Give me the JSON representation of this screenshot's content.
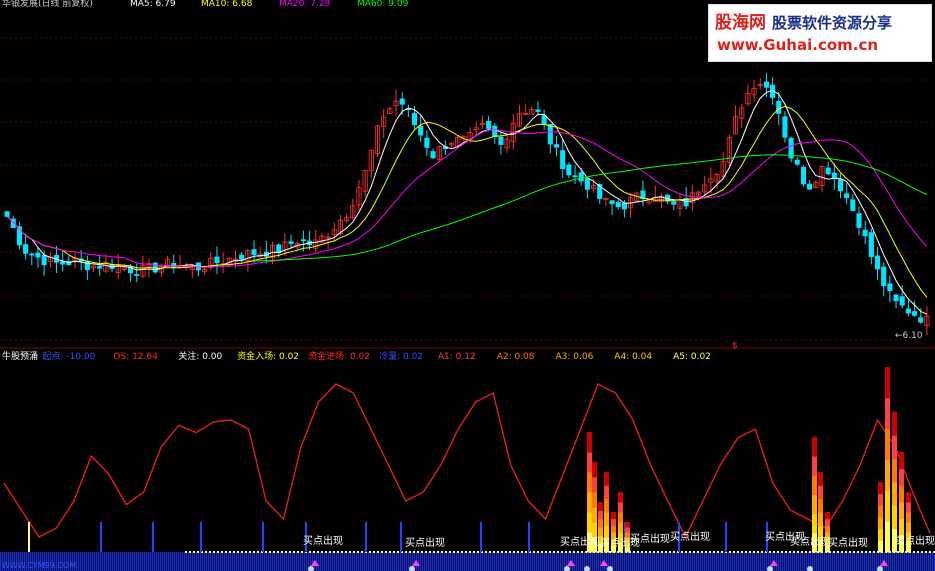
{
  "top_legend": [
    {
      "text": "华银发展(日线 前复权)",
      "color": "#c8c8c8"
    },
    {
      "text": "MA5: 6.79",
      "color": "#ffffff"
    },
    {
      "text": "MA10: 6.68",
      "color": "#ffff00"
    },
    {
      "text": "MA20: 7.29",
      "color": "#ff00ff"
    },
    {
      "text": "MA60: 9.09",
      "color": "#00ff00"
    }
  ],
  "low_label": "6.10",
  "watermark": {
    "line1": "股海网",
    "line2": "股票软件资源分享",
    "line3": "www.Guhai.com.cn"
  },
  "bottom_watermark": "WWW.CYM99.COM",
  "indicator_legend": [
    {
      "text": "牛股预涌",
      "color": "#ffffff"
    },
    {
      "text": "起点: -10.00",
      "color": "#3355ff"
    },
    {
      "text": "OS: 12.64",
      "color": "#ff2a2a"
    },
    {
      "text": "关注: 0.00",
      "color": "#ffffff"
    },
    {
      "text": "资金入场: 0.02",
      "color": "#ffff00"
    },
    {
      "text": "资金进场: 0.02",
      "color": "#ff2a2a"
    },
    {
      "text": "冷量: 0.02",
      "color": "#3355ff"
    },
    {
      "text": "A1: 0.12",
      "color": "#ff4040"
    },
    {
      "text": "A2: 0.08",
      "color": "#ff7a00"
    },
    {
      "text": "A3: 0.06",
      "color": "#ffaa00"
    },
    {
      "text": "A4: 0.04",
      "color": "#ffd200"
    },
    {
      "text": "A5: 0.02",
      "color": "#ffff60"
    }
  ],
  "signal_label": "买点出现",
  "chart_data": [
    {
      "type": "candlestick",
      "title": "华银发展(日线 前复权)",
      "series": [
        {
          "name": "MA5",
          "value": 6.79,
          "color": "#ffffff"
        },
        {
          "name": "MA10",
          "value": 6.68,
          "color": "#ffff00"
        },
        {
          "name": "MA20",
          "value": 7.29,
          "color": "#ff00ff"
        },
        {
          "name": "MA60",
          "value": 9.09,
          "color": "#00ff00"
        }
      ],
      "close_path": [
        8.3,
        7.6,
        7.4,
        7.3,
        7.35,
        7.25,
        7.3,
        7.2,
        7.15,
        7.25,
        7.3,
        7.2,
        7.3,
        7.4,
        7.5,
        7.55,
        7.6,
        7.8,
        7.7,
        8.0,
        8.4,
        9.2,
        10.4,
        10.8,
        10.2,
        9.6,
        9.9,
        9.9,
        10.2,
        9.8,
        10.5,
        10.6,
        9.8,
        9.2,
        9.0,
        8.6,
        8.5,
        8.7,
        8.8,
        8.5,
        8.6,
        9.1,
        9.4,
        10.6,
        11.2,
        10.9,
        9.6,
        8.9,
        9.4,
        8.9,
        8.2,
        7.2,
        6.5,
        6.3,
        6.1
      ],
      "low_price": 6.1,
      "colors": {
        "up": "#ff3030",
        "down": "#00e5ff"
      }
    },
    {
      "type": "line",
      "title": "牛股预涌",
      "series": [
        {
          "name": "OS",
          "color": "#e02020",
          "values": [
            40,
            25,
            10,
            15,
            30,
            55,
            45,
            28,
            35,
            60,
            72,
            68,
            74,
            75,
            70,
            30,
            20,
            60,
            85,
            95,
            90,
            70,
            50,
            30,
            35,
            50,
            70,
            85,
            90,
            50,
            30,
            20,
            45,
            70,
            95,
            90,
            75,
            50,
            30,
            10,
            30,
            50,
            65,
            70,
            40,
            25,
            20,
            15,
            30,
            50,
            75,
            60,
            35,
            12
          ]
        },
        {
          "name": "起点",
          "value": -10.0,
          "color": "#3355ff"
        },
        {
          "name": "关注",
          "value": 0.0,
          "color": "#ffffff"
        },
        {
          "name": "资金入场",
          "value": 0.02,
          "color": "#ffff00"
        },
        {
          "name": "资金进场",
          "value": 0.02,
          "color": "#ff2a2a"
        },
        {
          "name": "冷量",
          "value": 0.02,
          "color": "#3355ff"
        },
        {
          "name": "A1",
          "value": 0.12,
          "color": "#ff4040"
        },
        {
          "name": "A2",
          "value": 0.08,
          "color": "#ff7a00"
        },
        {
          "name": "A3",
          "value": 0.06,
          "color": "#ffaa00"
        },
        {
          "name": "A4",
          "value": 0.04,
          "color": "#ffd200"
        },
        {
          "name": "A5",
          "value": 0.02,
          "color": "#ffff60"
        }
      ],
      "signal_events": [
        "买点出现",
        "买点出现",
        "买点出现",
        "买点出现",
        "买点出现",
        "买点出现",
        "买点出现",
        "买点出现",
        "买点出现"
      ]
    }
  ]
}
